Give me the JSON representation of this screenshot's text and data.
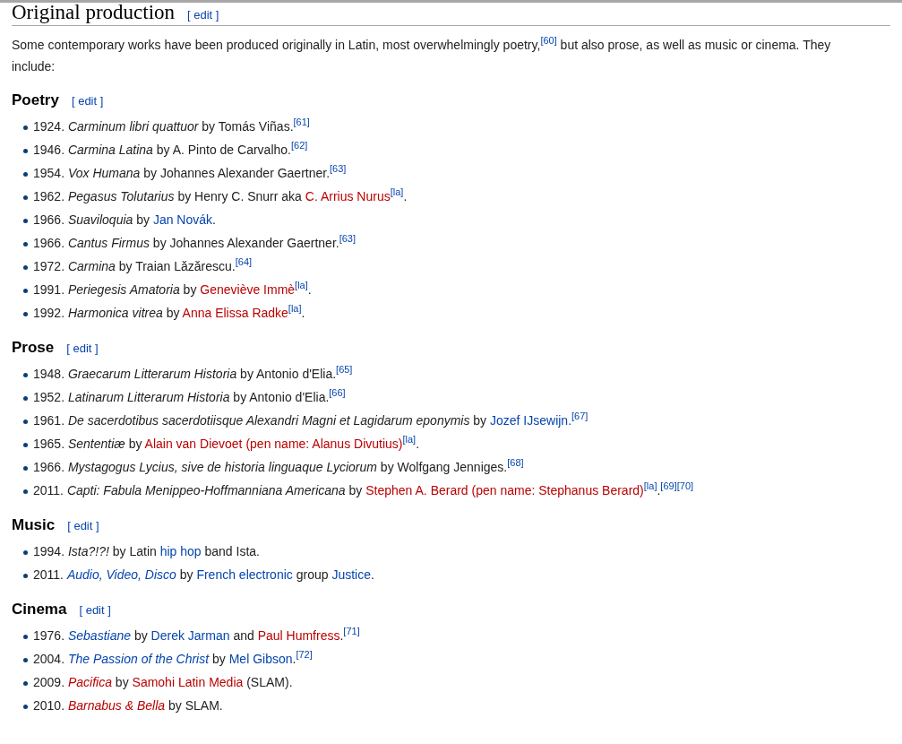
{
  "heading": {
    "title": "Original production",
    "edit": "[ edit ]"
  },
  "intro": [
    {
      "t": "Some contemporary works have been produced originally in Latin, most overwhelmingly poetry,",
      "kind": "text"
    },
    {
      "t": "[60]",
      "kind": "ref"
    },
    {
      "t": " but also prose, as well as music or cinema. They include:",
      "kind": "text"
    }
  ],
  "sections": [
    {
      "title": "Poetry",
      "edit": "[ edit ]",
      "items": [
        [
          {
            "t": "1924. ",
            "kind": "text"
          },
          {
            "t": "Carminum libri quattuor",
            "kind": "italic"
          },
          {
            "t": " by Tomás Viñas.",
            "kind": "text"
          },
          {
            "t": "[61]",
            "kind": "ref"
          }
        ],
        [
          {
            "t": "1946. ",
            "kind": "text"
          },
          {
            "t": "Carmina Latina",
            "kind": "italic"
          },
          {
            "t": " by A. Pinto de Carvalho.",
            "kind": "text"
          },
          {
            "t": "[62]",
            "kind": "ref"
          }
        ],
        [
          {
            "t": "1954. ",
            "kind": "text"
          },
          {
            "t": "Vox Humana",
            "kind": "italic"
          },
          {
            "t": " by Johannes Alexander Gaertner.",
            "kind": "text"
          },
          {
            "t": "[63]",
            "kind": "ref"
          }
        ],
        [
          {
            "t": "1962. ",
            "kind": "text"
          },
          {
            "t": "Pegasus Tolutarius",
            "kind": "italic"
          },
          {
            "t": " by Henry C. Snurr aka ",
            "kind": "text"
          },
          {
            "t": "C. Arrius Nurus",
            "kind": "red-link"
          },
          {
            "t": "[la]",
            "kind": "ref"
          },
          {
            "t": ".",
            "kind": "text"
          }
        ],
        [
          {
            "t": "1966. ",
            "kind": "text"
          },
          {
            "t": "Suaviloquia",
            "kind": "italic"
          },
          {
            "t": " by ",
            "kind": "text"
          },
          {
            "t": "Jan Novák",
            "kind": "link"
          },
          {
            "t": ".",
            "kind": "text"
          }
        ],
        [
          {
            "t": "1966. ",
            "kind": "text"
          },
          {
            "t": "Cantus Firmus",
            "kind": "italic"
          },
          {
            "t": " by Johannes Alexander Gaertner.",
            "kind": "text"
          },
          {
            "t": "[63]",
            "kind": "ref"
          }
        ],
        [
          {
            "t": "1972. ",
            "kind": "text"
          },
          {
            "t": "Carmina",
            "kind": "italic"
          },
          {
            "t": " by Traian Lăzărescu.",
            "kind": "text"
          },
          {
            "t": "[64]",
            "kind": "ref"
          }
        ],
        [
          {
            "t": "1991. ",
            "kind": "text"
          },
          {
            "t": "Periegesis Amatoria",
            "kind": "italic"
          },
          {
            "t": " by ",
            "kind": "text"
          },
          {
            "t": "Geneviève Immè",
            "kind": "red-link"
          },
          {
            "t": "[la]",
            "kind": "ref"
          },
          {
            "t": ".",
            "kind": "text"
          }
        ],
        [
          {
            "t": "1992. ",
            "kind": "text"
          },
          {
            "t": "Harmonica vitrea",
            "kind": "italic"
          },
          {
            "t": " by ",
            "kind": "text"
          },
          {
            "t": "Anna Elissa Radke",
            "kind": "red-link"
          },
          {
            "t": "[la]",
            "kind": "ref"
          },
          {
            "t": ".",
            "kind": "text"
          }
        ]
      ]
    },
    {
      "title": "Prose",
      "edit": "[ edit ]",
      "items": [
        [
          {
            "t": "1948. ",
            "kind": "text"
          },
          {
            "t": "Graecarum Litterarum Historia",
            "kind": "italic"
          },
          {
            "t": " by Antonio d'Elia.",
            "kind": "text"
          },
          {
            "t": "[65]",
            "kind": "ref"
          }
        ],
        [
          {
            "t": "1952. ",
            "kind": "text"
          },
          {
            "t": "Latinarum Litterarum Historia",
            "kind": "italic"
          },
          {
            "t": " by Antonio d'Elia.",
            "kind": "text"
          },
          {
            "t": "[66]",
            "kind": "ref"
          }
        ],
        [
          {
            "t": "1961. ",
            "kind": "text"
          },
          {
            "t": "De sacerdotibus sacerdotiisque Alexandri Magni et Lagidarum eponymis",
            "kind": "italic"
          },
          {
            "t": " by ",
            "kind": "text"
          },
          {
            "t": "Jozef IJsewijn.",
            "kind": "link"
          },
          {
            "t": "[67]",
            "kind": "ref"
          }
        ],
        [
          {
            "t": "1965. ",
            "kind": "text"
          },
          {
            "t": "Sententiæ",
            "kind": "italic"
          },
          {
            "t": " by ",
            "kind": "text"
          },
          {
            "t": "Alain van Dievoet (pen name: Alanus Divutius)",
            "kind": "red-link"
          },
          {
            "t": "[la]",
            "kind": "ref"
          },
          {
            "t": ".",
            "kind": "text"
          }
        ],
        [
          {
            "t": "1966. ",
            "kind": "text"
          },
          {
            "t": "Mystagogus Lycius, sive de historia linguaque Lyciorum",
            "kind": "italic"
          },
          {
            "t": " by Wolfgang Jenniges.",
            "kind": "text"
          },
          {
            "t": "[68]",
            "kind": "ref"
          }
        ],
        [
          {
            "t": "2011. ",
            "kind": "text"
          },
          {
            "t": "Capti: Fabula Menippeo-Hoffmanniana Americana",
            "kind": "italic"
          },
          {
            "t": " by ",
            "kind": "text"
          },
          {
            "t": "Stephen A. Berard (pen name: Stephanus Berard)",
            "kind": "red-link"
          },
          {
            "t": "[la]",
            "kind": "ref"
          },
          {
            "t": ".",
            "kind": "text"
          },
          {
            "t": "[69]",
            "kind": "ref"
          },
          {
            "t": "[70]",
            "kind": "ref"
          }
        ]
      ]
    },
    {
      "title": "Music",
      "edit": "[ edit ]",
      "items": [
        [
          {
            "t": "1994. ",
            "kind": "text"
          },
          {
            "t": "Ista?!?!",
            "kind": "italic"
          },
          {
            "t": " by Latin ",
            "kind": "text"
          },
          {
            "t": "hip hop",
            "kind": "link"
          },
          {
            "t": " band Ista.",
            "kind": "text"
          }
        ],
        [
          {
            "t": "2011. ",
            "kind": "text"
          },
          {
            "t": "Audio, Video, Disco",
            "kind": "italic-link"
          },
          {
            "t": " by ",
            "kind": "text"
          },
          {
            "t": "French electronic",
            "kind": "link"
          },
          {
            "t": " group ",
            "kind": "text"
          },
          {
            "t": "Justice",
            "kind": "link"
          },
          {
            "t": ".",
            "kind": "text"
          }
        ]
      ]
    },
    {
      "title": "Cinema",
      "edit": "[ edit ]",
      "items": [
        [
          {
            "t": "1976. ",
            "kind": "text"
          },
          {
            "t": "Sebastiane",
            "kind": "italic-link"
          },
          {
            "t": " by ",
            "kind": "text"
          },
          {
            "t": "Derek Jarman",
            "kind": "link"
          },
          {
            "t": " and ",
            "kind": "text"
          },
          {
            "t": "Paul Humfress",
            "kind": "red-link"
          },
          {
            "t": ".",
            "kind": "text"
          },
          {
            "t": "[71]",
            "kind": "ref"
          }
        ],
        [
          {
            "t": "2004. ",
            "kind": "text"
          },
          {
            "t": "The Passion of the Christ",
            "kind": "italic-link"
          },
          {
            "t": " by ",
            "kind": "text"
          },
          {
            "t": "Mel Gibson",
            "kind": "link"
          },
          {
            "t": ".",
            "kind": "text"
          },
          {
            "t": "[72]",
            "kind": "ref"
          }
        ],
        [
          {
            "t": "2009. ",
            "kind": "text"
          },
          {
            "t": "Pacifica",
            "kind": "italic-red-link"
          },
          {
            "t": " by ",
            "kind": "text"
          },
          {
            "t": "Samohi Latin Media",
            "kind": "red-link"
          },
          {
            "t": " (SLAM).",
            "kind": "text"
          }
        ],
        [
          {
            "t": "2010. ",
            "kind": "text"
          },
          {
            "t": "Barnabus & Bella",
            "kind": "italic-red-link"
          },
          {
            "t": " by SLAM.",
            "kind": "text"
          }
        ]
      ]
    }
  ]
}
